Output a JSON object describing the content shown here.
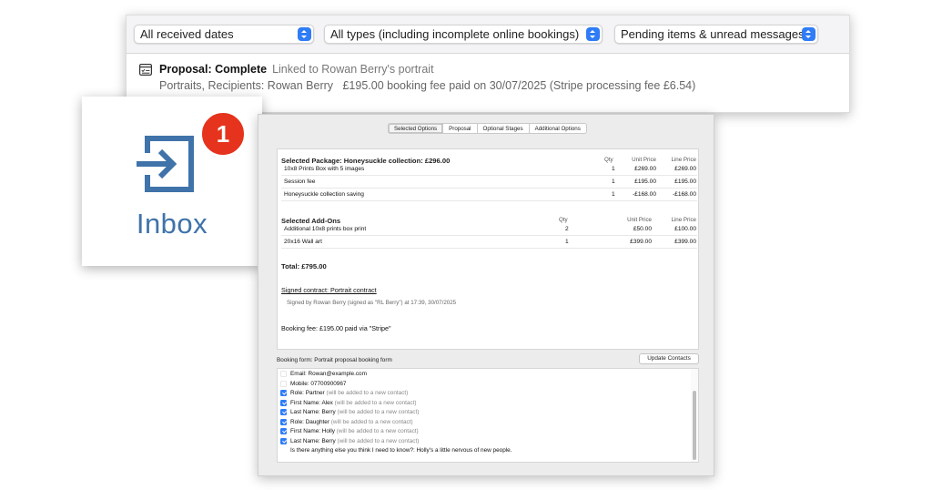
{
  "filters": {
    "date": "All received dates",
    "type": "All types (including incomplete online bookings)",
    "status": "Pending items & unread messages"
  },
  "proposal_item": {
    "title": "Proposal: Complete",
    "linked": "Linked to Rowan Berry's portrait",
    "recipients": "Portraits, Recipients: Rowan Berry",
    "fee": "£195.00 booking fee paid on 30/07/2025 (Stripe processing fee £6.54)",
    "icon": "checklist-icon"
  },
  "inbox": {
    "label": "Inbox",
    "badge": "1",
    "icon": "inbox-arrow-icon",
    "color": "#3f73a9",
    "badge_color": "#e5331d"
  },
  "tabs": [
    {
      "label": "Selected Options",
      "active": true
    },
    {
      "label": "Proposal",
      "active": false
    },
    {
      "label": "Optional Stages",
      "active": false
    },
    {
      "label": "Additional Options",
      "active": false
    }
  ],
  "package": {
    "title": "Selected Package: Honeysuckle collection: £296.00",
    "headers": {
      "qty": "Qty",
      "unit": "Unit Price",
      "line": "Line Price"
    },
    "rows": [
      {
        "item": "10x8 Prints Box with 5 images",
        "qty": "1",
        "unit": "£269.00",
        "line": "£269.00"
      },
      {
        "item": "Session fee",
        "qty": "1",
        "unit": "£195.00",
        "line": "£195.00"
      },
      {
        "item": "Honeysuckle collection saving",
        "qty": "1",
        "unit": "-£168.00",
        "line": "-£168.00"
      }
    ]
  },
  "addons": {
    "title": "Selected Add-Ons",
    "headers": {
      "qty": "Qty",
      "unit": "Unit Price",
      "line": "Line Price"
    },
    "rows": [
      {
        "item": "Additional 10x8 prints box print",
        "qty": "2",
        "unit": "£50.00",
        "line": "£100.00"
      },
      {
        "item": "20x16 Wall art",
        "qty": "1",
        "unit": "£399.00",
        "line": "£399.00"
      }
    ]
  },
  "total": "Total: £795.00",
  "contract": {
    "link": "Signed contract: Portrait contract",
    "signed_by": "Signed by Rowan Berry (signed as \"RL Berry\") at 17:39, 30/07/2025"
  },
  "booking_fee": "Booking fee: £195.00 paid via \"Stripe\"",
  "booking_form": {
    "label": "Booking form: Portrait proposal booking form",
    "update_button": "Update Contacts",
    "rows": [
      {
        "text": "Email: Rowan@example.com",
        "note": "",
        "checkbox": "unchecked"
      },
      {
        "text": "Mobile: 07700900967",
        "note": "",
        "checkbox": "unchecked"
      },
      {
        "text": "Role: Partner",
        "note": "(will be added to a new contact)",
        "checkbox": "checked"
      },
      {
        "text": "First Name: Alex",
        "note": "(will be added to a new contact)",
        "checkbox": "checked"
      },
      {
        "text": "Last Name: Berry",
        "note": "(will be added to a new contact)",
        "checkbox": "checked"
      },
      {
        "text": "Role: Daughter",
        "note": "(will be added to a new contact)",
        "checkbox": "checked"
      },
      {
        "text": "First Name: Holly",
        "note": "(will be added to a new contact)",
        "checkbox": "checked"
      },
      {
        "text": "Last Name: Berry",
        "note": "(will be added to a new contact)",
        "checkbox": "checked"
      },
      {
        "text": "Is there anything else you think I need to know?: Holly's a little nervous of new people.",
        "note": "",
        "checkbox": "none"
      }
    ]
  },
  "colors": {
    "accent": "#2f7cf6"
  }
}
